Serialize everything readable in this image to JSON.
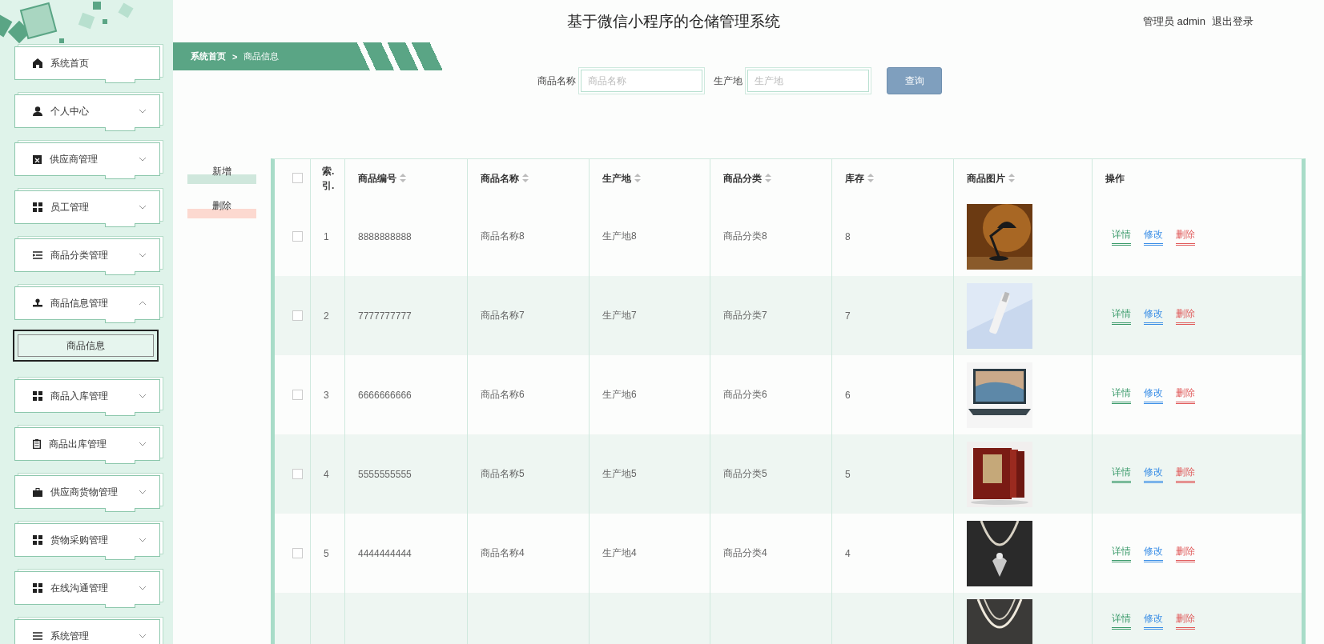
{
  "header": {
    "title": "基于微信小程序的仓储管理系统",
    "user": "管理员 admin",
    "logout": "退出登录"
  },
  "breadcrumb": {
    "items": [
      "系统首页",
      "商品信息"
    ],
    "separator": ">"
  },
  "sidebar": {
    "items": [
      {
        "label": "系统首页",
        "kind": "link"
      },
      {
        "label": "个人中心",
        "kind": "menu",
        "expanded": false
      },
      {
        "label": "供应商管理",
        "kind": "menu",
        "expanded": false
      },
      {
        "label": "员工管理",
        "kind": "menu",
        "expanded": false
      },
      {
        "label": "商品分类管理",
        "kind": "menu",
        "expanded": false
      },
      {
        "label": "商品信息管理",
        "kind": "menu",
        "expanded": true,
        "children": [
          {
            "label": "商品信息",
            "selected": true
          }
        ]
      },
      {
        "label": "商品入库管理",
        "kind": "menu",
        "expanded": false
      },
      {
        "label": "商品出库管理",
        "kind": "menu",
        "expanded": false
      },
      {
        "label": "供应商货物管理",
        "kind": "menu",
        "expanded": false
      },
      {
        "label": "货物采购管理",
        "kind": "menu",
        "expanded": false
      },
      {
        "label": "在线沟通管理",
        "kind": "menu",
        "expanded": false
      },
      {
        "label": "系统管理",
        "kind": "menu",
        "expanded": false
      }
    ]
  },
  "search": {
    "fields": [
      {
        "label": "商品名称",
        "placeholder": "商品名称"
      },
      {
        "label": "生产地",
        "placeholder": "生产地"
      }
    ],
    "button": "查询"
  },
  "actions": [
    {
      "label": "新增",
      "kind": "add"
    },
    {
      "label": "删除",
      "kind": "delete"
    }
  ],
  "table": {
    "columns": [
      {
        "label": "索.引.",
        "sortable": false
      },
      {
        "label": "商品编号",
        "sortable": true
      },
      {
        "label": "商品名称",
        "sortable": true
      },
      {
        "label": "生产地",
        "sortable": true
      },
      {
        "label": "商品分类",
        "sortable": true
      },
      {
        "label": "库存",
        "sortable": true
      },
      {
        "label": "商品图片",
        "sortable": true
      },
      {
        "label": "操作",
        "sortable": false
      }
    ],
    "all_checked": false,
    "rows": [
      {
        "checked": false,
        "cells": [
          "1",
          "8888888888",
          "商品名称8",
          "生产地8",
          "商品分类8",
          "8"
        ],
        "actions": [
          {
            "label": "详情",
            "color": "#3a9a6a"
          },
          {
            "label": "修改",
            "color": "#3a8ee6"
          },
          {
            "label": "删除",
            "color": "#e05a5a"
          }
        ]
      },
      {
        "checked": false,
        "cells": [
          "2",
          "7777777777",
          "商品名称7",
          "生产地7",
          "商品分类7",
          "7"
        ],
        "actions": [
          {
            "label": "详情",
            "color": "#3a9a6a"
          },
          {
            "label": "修改",
            "color": "#3a8ee6"
          },
          {
            "label": "删除",
            "color": "#e05a5a"
          }
        ]
      },
      {
        "checked": false,
        "cells": [
          "3",
          "6666666666",
          "商品名称6",
          "生产地6",
          "商品分类6",
          "6"
        ],
        "actions": [
          {
            "label": "详情",
            "color": "#3a9a6a"
          },
          {
            "label": "修改",
            "color": "#3a8ee6"
          },
          {
            "label": "删除",
            "color": "#e05a5a"
          }
        ]
      },
      {
        "checked": false,
        "cells": [
          "4",
          "5555555555",
          "商品名称5",
          "生产地5",
          "商品分类5",
          "5"
        ],
        "actions": [
          {
            "label": "详情",
            "color": "#3a9a6a"
          },
          {
            "label": "修改",
            "color": "#3a8ee6"
          },
          {
            "label": "删除",
            "color": "#e05a5a"
          }
        ]
      },
      {
        "checked": false,
        "cells": [
          "5",
          "4444444444",
          "商品名称4",
          "生产地4",
          "商品分类4",
          "4"
        ],
        "actions": [
          {
            "label": "详情",
            "color": "#3a9a6a"
          },
          {
            "label": "修改",
            "color": "#3a8ee6"
          },
          {
            "label": "删除",
            "color": "#e05a5a"
          }
        ]
      },
      {
        "cells": [],
        "actions": [
          {
            "label": "详情",
            "color": "#3a9a6a"
          },
          {
            "label": "修改",
            "color": "#3a8ee6"
          },
          {
            "label": "删除",
            "color": "#e05a5a"
          }
        ]
      }
    ]
  }
}
